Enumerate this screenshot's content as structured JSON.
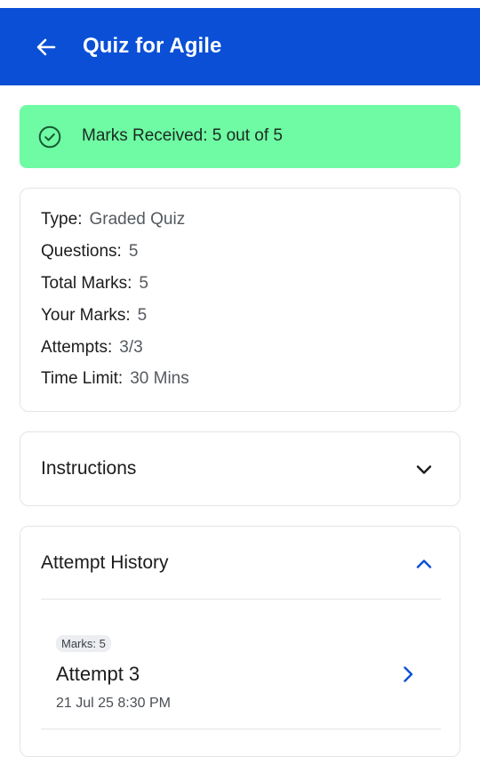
{
  "app_bar": {
    "title": "Quiz for Agile",
    "back_icon": "arrow-left-icon",
    "background": "#0a4fd6"
  },
  "marks_banner": {
    "text": "Marks Received: 5 out of 5",
    "icon": "check-circle-icon",
    "background": "#6efba3"
  },
  "details": [
    {
      "label": "Type:",
      "value": "Graded Quiz"
    },
    {
      "label": "Questions:",
      "value": "5"
    },
    {
      "label": "Total Marks:",
      "value": "5"
    },
    {
      "label": "Your Marks:",
      "value": "5"
    },
    {
      "label": "Attempts:",
      "value": "3/3"
    },
    {
      "label": "Time Limit:",
      "value": "30 Mins"
    }
  ],
  "instructions": {
    "title": "Instructions",
    "icon": "chevron-down-icon"
  },
  "attempt_history": {
    "title": "Attempt History",
    "icon": "chevron-up-icon",
    "accent": "#0a4fd6",
    "attempts": [
      {
        "marks_chip": "Marks: 5",
        "name": "Attempt 3",
        "date": "21 Jul 25 8:30 PM",
        "icon": "chevron-right-icon"
      }
    ]
  }
}
